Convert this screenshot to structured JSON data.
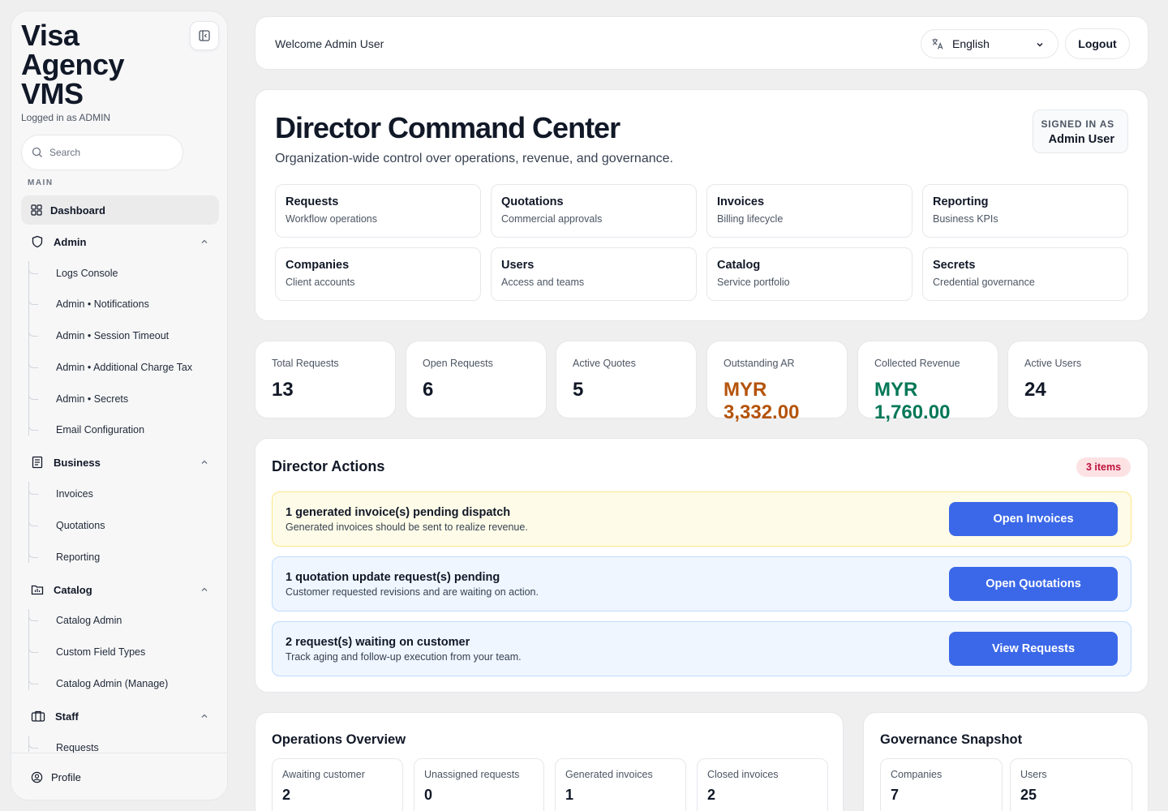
{
  "sidebar": {
    "brand": "Visa Agency VMS",
    "logged_in": "Logged in as ADMIN",
    "search_placeholder": "Search",
    "section_main": "MAIN",
    "dashboard": "Dashboard",
    "admin": {
      "label": "Admin",
      "items": [
        "Logs Console",
        "Admin • Notifications",
        "Admin • Session Timeout",
        "Admin • Additional Charge Tax",
        "Admin • Secrets",
        "Email Configuration"
      ]
    },
    "business": {
      "label": "Business",
      "items": [
        "Invoices",
        "Quotations",
        "Reporting"
      ]
    },
    "catalog": {
      "label": "Catalog",
      "items": [
        "Catalog Admin",
        "Custom Field Types",
        "Catalog Admin (Manage)"
      ]
    },
    "staff": {
      "label": "Staff",
      "items": [
        "Requests"
      ]
    },
    "profile": "Profile"
  },
  "topbar": {
    "welcome": "Welcome Admin User",
    "language": "English",
    "logout": "Logout"
  },
  "hero": {
    "title": "Director Command Center",
    "subtitle": "Organization-wide control over operations, revenue, and governance.",
    "signed_in_label": "SIGNED IN AS",
    "signed_in_user": "Admin User",
    "links": [
      {
        "title": "Requests",
        "sub": "Workflow operations"
      },
      {
        "title": "Quotations",
        "sub": "Commercial approvals"
      },
      {
        "title": "Invoices",
        "sub": "Billing lifecycle"
      },
      {
        "title": "Reporting",
        "sub": "Business KPIs"
      },
      {
        "title": "Companies",
        "sub": "Client accounts"
      },
      {
        "title": "Users",
        "sub": "Access and teams"
      },
      {
        "title": "Catalog",
        "sub": "Service portfolio"
      },
      {
        "title": "Secrets",
        "sub": "Credential governance"
      }
    ]
  },
  "stats": [
    {
      "label": "Total Requests",
      "value": "13",
      "color": "#111827"
    },
    {
      "label": "Open Requests",
      "value": "6",
      "color": "#111827"
    },
    {
      "label": "Active Quotes",
      "value": "5",
      "color": "#111827"
    },
    {
      "label": "Outstanding AR",
      "value": "MYR 3,332.00",
      "color": "#b45309"
    },
    {
      "label": "Collected Revenue",
      "value": "MYR 1,760.00",
      "color": "#047857"
    },
    {
      "label": "Active Users",
      "value": "24",
      "color": "#111827"
    }
  ],
  "actions": {
    "title": "Director Actions",
    "badge": "3 items",
    "rows": [
      {
        "title": "1 generated invoice(s) pending dispatch",
        "sub": "Generated invoices should be sent to realize revenue.",
        "button": "Open Invoices",
        "bg": "#fefce8",
        "border": "#fde68a"
      },
      {
        "title": "1 quotation update request(s) pending",
        "sub": "Customer requested revisions and are waiting on action.",
        "button": "Open Quotations",
        "bg": "#eff6ff",
        "border": "#bfdbfe"
      },
      {
        "title": "2 request(s) waiting on customer",
        "sub": "Track aging and follow-up execution from your team.",
        "button": "View Requests",
        "bg": "#eff6ff",
        "border": "#bfdbfe"
      }
    ]
  },
  "operations": {
    "title": "Operations Overview",
    "items": [
      {
        "label": "Awaiting customer",
        "value": "2"
      },
      {
        "label": "Unassigned requests",
        "value": "0"
      },
      {
        "label": "Generated invoices",
        "value": "1"
      },
      {
        "label": "Closed invoices",
        "value": "2"
      }
    ]
  },
  "governance": {
    "title": "Governance Snapshot",
    "items": [
      {
        "label": "Companies",
        "value": "7"
      },
      {
        "label": "Users",
        "value": "25"
      }
    ]
  },
  "colors": {
    "primary_button": "#3b68e8",
    "badge_bg": "#fde2e4",
    "badge_text": "#be123c"
  }
}
